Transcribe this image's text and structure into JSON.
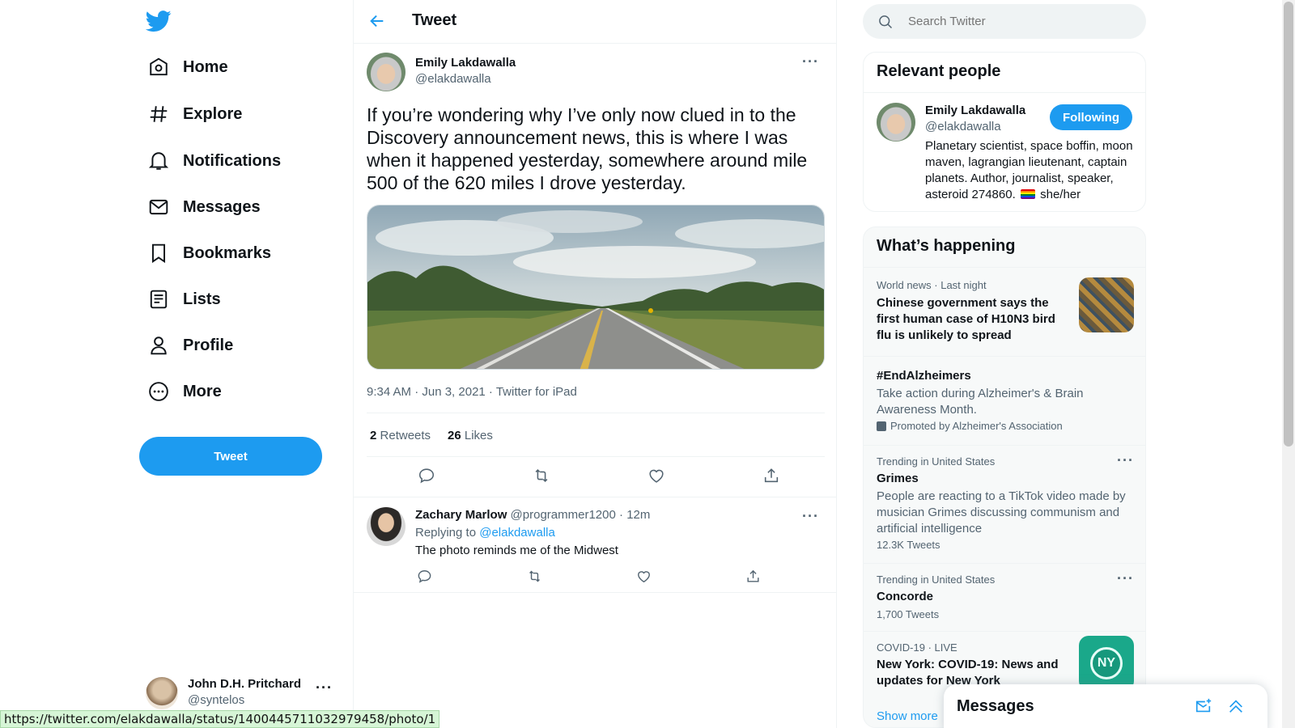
{
  "nav": {
    "items": [
      {
        "label": "Home",
        "icon": "home-icon"
      },
      {
        "label": "Explore",
        "icon": "hashtag-icon"
      },
      {
        "label": "Notifications",
        "icon": "bell-icon"
      },
      {
        "label": "Messages",
        "icon": "envelope-icon"
      },
      {
        "label": "Bookmarks",
        "icon": "bookmark-icon"
      },
      {
        "label": "Lists",
        "icon": "list-icon"
      },
      {
        "label": "Profile",
        "icon": "person-icon"
      },
      {
        "label": "More",
        "icon": "more-circle-icon"
      }
    ],
    "tweet_button": "Tweet",
    "account": {
      "name": "John D.H. Pritchard",
      "handle": "@syntelos"
    }
  },
  "header": {
    "title": "Tweet"
  },
  "tweet": {
    "author_name": "Emily Lakdawalla",
    "author_handle": "@elakdawalla",
    "text": "If you’re wondering why I’ve only now clued in to the Discovery announcement news, this is where I was when it happened yesterday, somewhere around mile 500 of the 620 miles I drove yesterday.",
    "timestamp": "9:34 AM · Jun 3, 2021 · Twitter for iPad",
    "retweets_count": "2",
    "retweets_label": "Retweets",
    "likes_count": "26",
    "likes_label": "Likes"
  },
  "reply": {
    "author_name": "Zachary Marlow",
    "author_handle": "@programmer1200",
    "time": "12m",
    "replying_prefix": "Replying to",
    "replying_to": "@elakdawalla",
    "text": "The photo reminds me of the Midwest"
  },
  "search": {
    "placeholder": "Search Twitter"
  },
  "relevant_people": {
    "title": "Relevant people",
    "name": "Emily Lakdawalla",
    "handle": "@elakdawalla",
    "follow_label": "Following",
    "bio": "Planetary scientist, space boffin, moon maven, lagrangian lieutenant, captain planets. Author, journalist, speaker, asteroid 274860.",
    "pronouns": "she/her"
  },
  "whats_happening": {
    "title": "What’s happening",
    "trends": [
      {
        "meta": "World news · Last night",
        "title": "Chinese government says the first human case of H10N3 bird flu is unlikely to spread"
      },
      {
        "title": "#EndAlzheimers",
        "desc": "Take action during Alzheimer's & Brain Awareness Month.",
        "promoted": "Promoted by Alzheimer's Association"
      },
      {
        "meta": "Trending in United States",
        "title": "Grimes",
        "desc": "People are reacting to a TikTok video made by musician Grimes discussing communism and artificial intelligence",
        "count": "12.3K Tweets"
      },
      {
        "meta": "Trending in United States",
        "title": "Concorde",
        "count": "1,700 Tweets"
      },
      {
        "meta": "COVID-19 · LIVE",
        "title": "New York: COVID-19: News and updates for New York",
        "badge": "NY"
      }
    ],
    "show_more": "Show more"
  },
  "messages_drawer": {
    "title": "Messages"
  },
  "status_url": "https://twitter.com/elakdawalla/status/1400445711032979458/photo/1",
  "colors": {
    "accent": "#1d9bf0",
    "text": "#0f1419",
    "secondary": "#536471"
  }
}
